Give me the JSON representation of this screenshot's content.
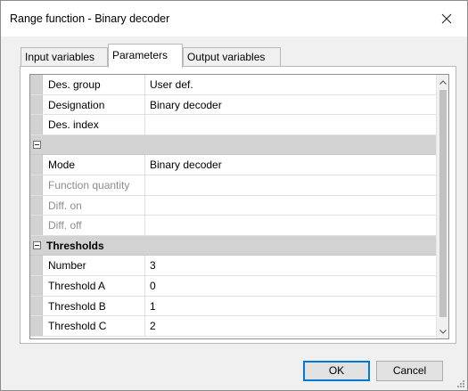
{
  "window": {
    "title": "Range function - Binary decoder",
    "close_icon": "close-icon"
  },
  "tabs": [
    {
      "label": "Input variables",
      "active": false
    },
    {
      "label": "Parameters",
      "active": true
    },
    {
      "label": "Output variables",
      "active": false
    }
  ],
  "grid": {
    "rows": [
      {
        "type": "property",
        "name": "Des. group",
        "value": "User def."
      },
      {
        "type": "property",
        "name": "Designation",
        "value": "Binary decoder"
      },
      {
        "type": "property",
        "name": "Des. index",
        "value": ""
      },
      {
        "type": "category",
        "name": "",
        "expanded": true
      },
      {
        "type": "property",
        "name": "Mode",
        "value": "Binary decoder"
      },
      {
        "type": "property",
        "name": "Function quantity",
        "value": "",
        "disabled": true
      },
      {
        "type": "property",
        "name": "Diff. on",
        "value": "",
        "disabled": true
      },
      {
        "type": "property",
        "name": "Diff. off",
        "value": "",
        "disabled": true
      },
      {
        "type": "category",
        "name": "Thresholds",
        "expanded": true
      },
      {
        "type": "property",
        "name": "Number",
        "value": "3"
      },
      {
        "type": "property",
        "name": "Threshold A",
        "value": "0"
      },
      {
        "type": "property",
        "name": "Threshold B",
        "value": "1"
      },
      {
        "type": "property",
        "name": "Threshold C",
        "value": "2"
      }
    ]
  },
  "buttons": {
    "ok": "OK",
    "cancel": "Cancel"
  }
}
